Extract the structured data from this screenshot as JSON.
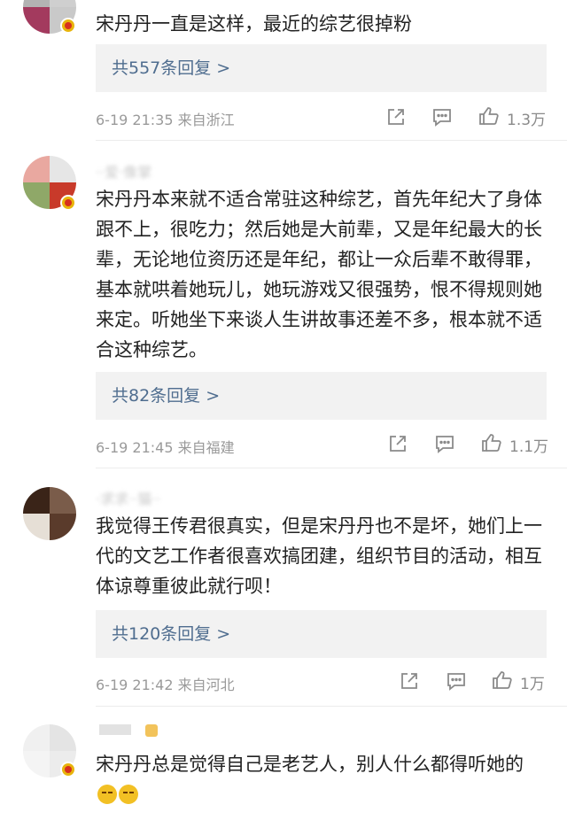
{
  "comments": [
    {
      "text": "宋丹丹一直是这样，最近的综艺很掉粉",
      "replies_label": "共557条回复 >",
      "meta": "6-19 21:35 来自浙江",
      "likes": "1.3万"
    },
    {
      "username": "··爱·像掌",
      "text": "宋丹丹本来就不适合常驻这种综艺，首先年纪大了身体跟不上，很吃力；然后她是大前辈，又是年纪最大的长辈，无论地位资历还是年纪，都让一众后辈不敢得罪，基本就哄着她玩儿，她玩游戏又很强势，恨不得规则她来定。听她坐下来谈人生讲故事还差不多，根本就不适合这种综艺。",
      "replies_label": "共82条回复 >",
      "meta": "6-19 21:45 来自福建",
      "likes": "1.1万"
    },
    {
      "username": "·求求··猫··",
      "text": "我觉得王传君很真实，但是宋丹丹也不是坏，她们上一代的文艺工作者很喜欢搞团建，组织节目的活动，相互体谅尊重彼此就行呗！",
      "replies_label": "共120条回复 >",
      "meta": "6-19 21:42 来自河北",
      "likes": "1万"
    },
    {
      "text": "宋丹丹总是觉得自己是老艺人，别人什么都得听她的"
    }
  ],
  "icons": {
    "share": "share-icon",
    "comment": "comment-icon",
    "like": "thumbs-up-icon"
  },
  "colors": {
    "link": "#4f6d8f",
    "reply_bg": "#f2f2f2",
    "meta": "#9a9a9a",
    "badge": "#e8b40c"
  }
}
